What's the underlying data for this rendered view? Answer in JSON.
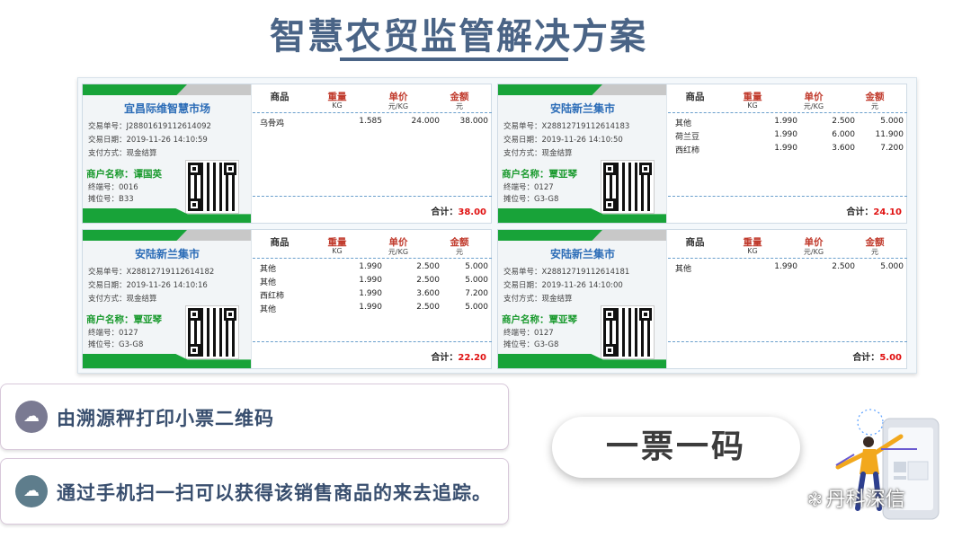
{
  "page": {
    "title": "智慧农贸监管解决方案"
  },
  "receipt_headers": {
    "product": "商品",
    "weight": "重量",
    "unit_price": "单价",
    "amount": "金额",
    "weight_unit": "KG",
    "price_unit": "元/KG",
    "amount_unit": "元",
    "total_label": "合计："
  },
  "receipts": [
    {
      "market": "宜昌际维智慧市场",
      "txn_label": "交易单号：J28801619112614092",
      "date_label": "交易日期：2019-11-26 14:10:59",
      "pay_label": "支付方式：现金结算",
      "merchant": "商户名称：谭国英",
      "terminal": "终端号：0016",
      "stall": "摊位号：B33",
      "items": [
        {
          "name": "乌骨鸡",
          "weight": "1.585",
          "price": "24.000",
          "amount": "38.000"
        }
      ],
      "total": "38.00"
    },
    {
      "market": "安陆新兰集市",
      "txn_label": "交易单号：X28812719112614183",
      "date_label": "交易日期：2019-11-26 14:10:50",
      "pay_label": "支付方式：现金结算",
      "merchant": "商户名称：覃亚琴",
      "terminal": "终端号：0127",
      "stall": "摊位号：G3-G8",
      "items": [
        {
          "name": "其他",
          "weight": "1.990",
          "price": "2.500",
          "amount": "5.000"
        },
        {
          "name": "荷兰豆",
          "weight": "1.990",
          "price": "6.000",
          "amount": "11.900"
        },
        {
          "name": "西红柿",
          "weight": "1.990",
          "price": "3.600",
          "amount": "7.200"
        }
      ],
      "total": "24.10"
    },
    {
      "market": "安陆新兰集市",
      "txn_label": "交易单号：X28812719112614182",
      "date_label": "交易日期：2019-11-26 14:10:16",
      "pay_label": "支付方式：现金结算",
      "merchant": "商户名称：覃亚琴",
      "terminal": "终端号：0127",
      "stall": "摊位号：G3-G8",
      "items": [
        {
          "name": "其他",
          "weight": "1.990",
          "price": "2.500",
          "amount": "5.000"
        },
        {
          "name": "其他",
          "weight": "1.990",
          "price": "2.500",
          "amount": "5.000"
        },
        {
          "name": "西红柿",
          "weight": "1.990",
          "price": "3.600",
          "amount": "7.200"
        },
        {
          "name": "其他",
          "weight": "1.990",
          "price": "2.500",
          "amount": "5.000"
        }
      ],
      "total": "22.20"
    },
    {
      "market": "安陆新兰集市",
      "txn_label": "交易单号：X28812719112614181",
      "date_label": "交易日期：2019-11-26 14:10:00",
      "pay_label": "支付方式：现金结算",
      "merchant": "商户名称：覃亚琴",
      "terminal": "终端号：0127",
      "stall": "摊位号：G3-G8",
      "items": [
        {
          "name": "其他",
          "weight": "1.990",
          "price": "2.500",
          "amount": "5.000"
        }
      ],
      "total": "5.00"
    }
  ],
  "features": [
    {
      "text": "由溯源秤打印小票二维码",
      "icon": "cloud-icon"
    },
    {
      "text": "通过手机扫一扫可以获得该销售商品的来去追踪。",
      "icon": "cloud-icon"
    }
  ],
  "slogan": "一票一码",
  "watermark": "丹科深信",
  "colors": {
    "title": "#4a6486",
    "accent_green": "#18a339",
    "market_blue": "#2b6cb7",
    "merchant_green": "#1a9a2e",
    "total_red": "#e01010",
    "icon_bg": "#7a7a92"
  }
}
